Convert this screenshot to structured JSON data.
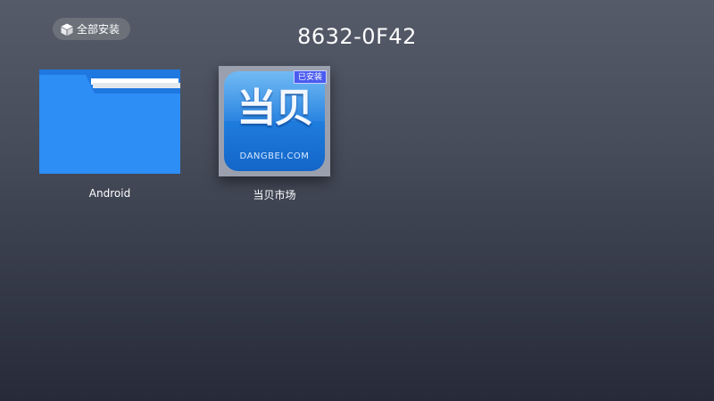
{
  "header": {
    "install_all_label": "全部安装",
    "install_all_icon": "box-icon",
    "device_title": "8632-0F42"
  },
  "tiles": [
    {
      "name": "Android",
      "label": "Android",
      "icon": "folder-icon",
      "color": "#2d8ef5"
    },
    {
      "name": "当贝市场",
      "label": "当贝市场",
      "icon": "dangbei-app-icon",
      "icon_text": "当贝",
      "icon_subtext": "DANGBEI.COM",
      "badge": "已安装",
      "badge_color": "#4a5bf0",
      "focused": true
    }
  ],
  "colors": {
    "background_top": "#555b69",
    "background_bottom": "#272b39",
    "pill": "#6b7079"
  }
}
